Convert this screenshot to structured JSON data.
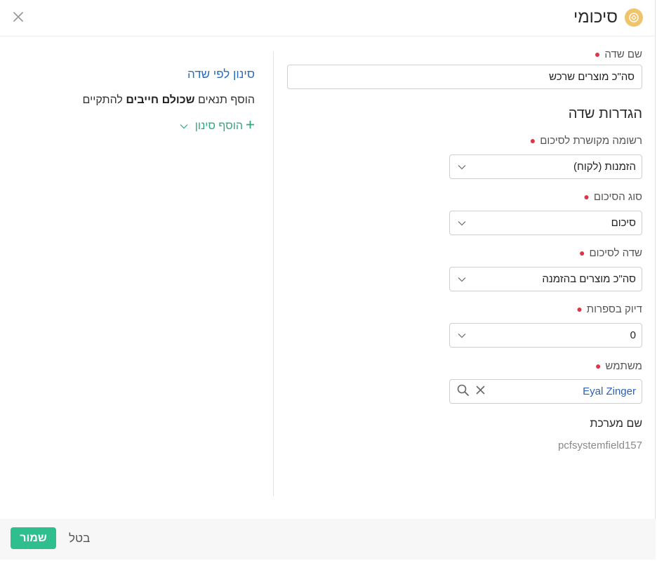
{
  "header": {
    "title": "סיכומי",
    "icon": "summary-icon",
    "close_icon": "close-icon"
  },
  "form": {
    "field_name_label": "שם שדה",
    "field_name_value": "סה\"כ מוצרים שרכש",
    "settings_title": "הגדרות שדה",
    "related_record_label": "רשומה מקושרת לסיכום",
    "related_record_value": "הזמנות (לקוח)",
    "summary_type_label": "סוג הסיכום",
    "summary_type_value": "סיכום",
    "summary_field_label": "שדה לסיכום",
    "summary_field_value": "סה\"כ מוצרים בהזמנה",
    "precision_label": "דיוק בספרות",
    "precision_value": "0",
    "user_label": "משתמש",
    "user_value": "Eyal Zinger",
    "system_name_label": "שם מערכת",
    "system_name_value": "pcfsystemfield157"
  },
  "filter": {
    "title": "סינון לפי שדה",
    "desc_prefix": "הוסף תנאים",
    "desc_bold": "שכולם חייבים",
    "desc_suffix": "להתקיים",
    "add_label": "הוסף סינון"
  },
  "footer": {
    "save_label": "שמור",
    "cancel_label": "בטל"
  },
  "colors": {
    "accent_green": "#2fbf8f",
    "link_blue": "#2d6cc0",
    "required_red": "#e0344b",
    "icon_yellow": "#f0c46a"
  }
}
